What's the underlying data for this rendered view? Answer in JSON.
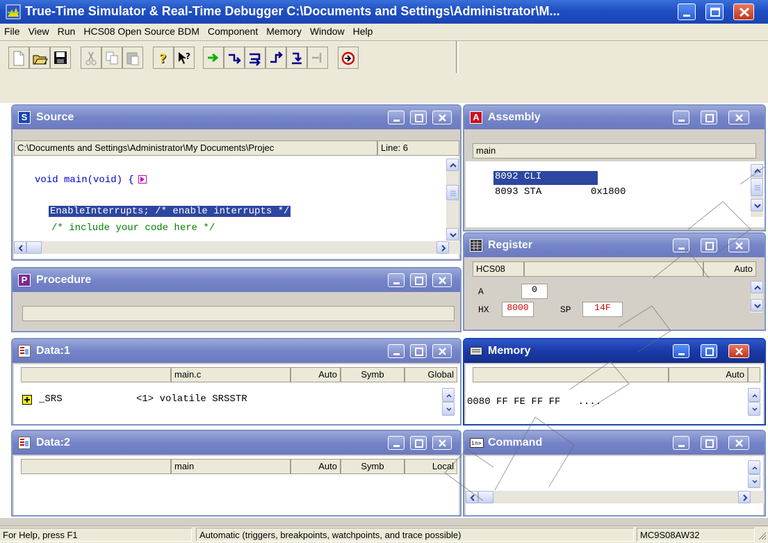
{
  "app": {
    "title": "True-Time Simulator & Real-Time Debugger   C:\\Documents and Settings\\Administrator\\M..."
  },
  "menu": [
    "File",
    "View",
    "Run",
    "HCS08 Open Source BDM",
    "Component",
    "Memory",
    "Window",
    "Help"
  ],
  "toolbar_icons": [
    "new-file-icon",
    "open-folder-icon",
    "save-icon",
    "cut-icon",
    "copy-icon",
    "paste-icon",
    "help-icon",
    "context-help-icon",
    "start-continue-icon",
    "single-step-icon",
    "step-over-icon",
    "step-out-icon",
    "assembly-step-icon",
    "halt-icon",
    "reset-icon"
  ],
  "source": {
    "title": "Source",
    "icon_letter": "S",
    "path": "C:\\Documents and Settings\\Administrator\\My Documents\\Projec",
    "line": "Line: 6",
    "lines": [
      "void main(void) {",
      "EnableInterrupts; /* enable interrupts */",
      "/* include your code here */"
    ]
  },
  "assembly": {
    "title": "Assembly",
    "icon_letter": "A",
    "header": "main",
    "rows": [
      {
        "addr": "8092",
        "mnemonic": "CLI",
        "operand": ""
      },
      {
        "addr": "8093",
        "mnemonic": "STA",
        "operand": "0x1800"
      }
    ]
  },
  "procedure": {
    "title": "Procedure",
    "icon_letter": "P"
  },
  "register": {
    "title": "Register",
    "cpu": "HCS08",
    "mode": "Auto",
    "a_label": "A",
    "a_value": "0",
    "hx_label": "HX",
    "hx_value": "8000",
    "sp_label": "SP",
    "sp_value": "14F"
  },
  "data1": {
    "title": "Data:1",
    "file": "main.c",
    "format": "Auto",
    "mode": "Symb",
    "scope": "Global",
    "row_name": "_SRS",
    "row_value": "<1> volatile SRSSTR"
  },
  "memory": {
    "title": "Memory",
    "mode": "Auto",
    "row": "0080 FF FE FF FF   ...."
  },
  "data2": {
    "title": "Data:2",
    "file": "main",
    "format": "Auto",
    "mode": "Symb",
    "scope": "Local"
  },
  "command": {
    "title": "Command"
  },
  "status": {
    "help": "For Help, press F1",
    "mode": "Automatic (triggers, breakpoints, watchpoints, and trace possible)",
    "device": "MC9S08AW32"
  },
  "colors": {
    "title_active": "#1945b2",
    "title_inactive": "#7584c8",
    "selection": "#2d46a0",
    "keyword": "#0000cc",
    "comment": "#008000",
    "register_changed": "#d00000"
  }
}
